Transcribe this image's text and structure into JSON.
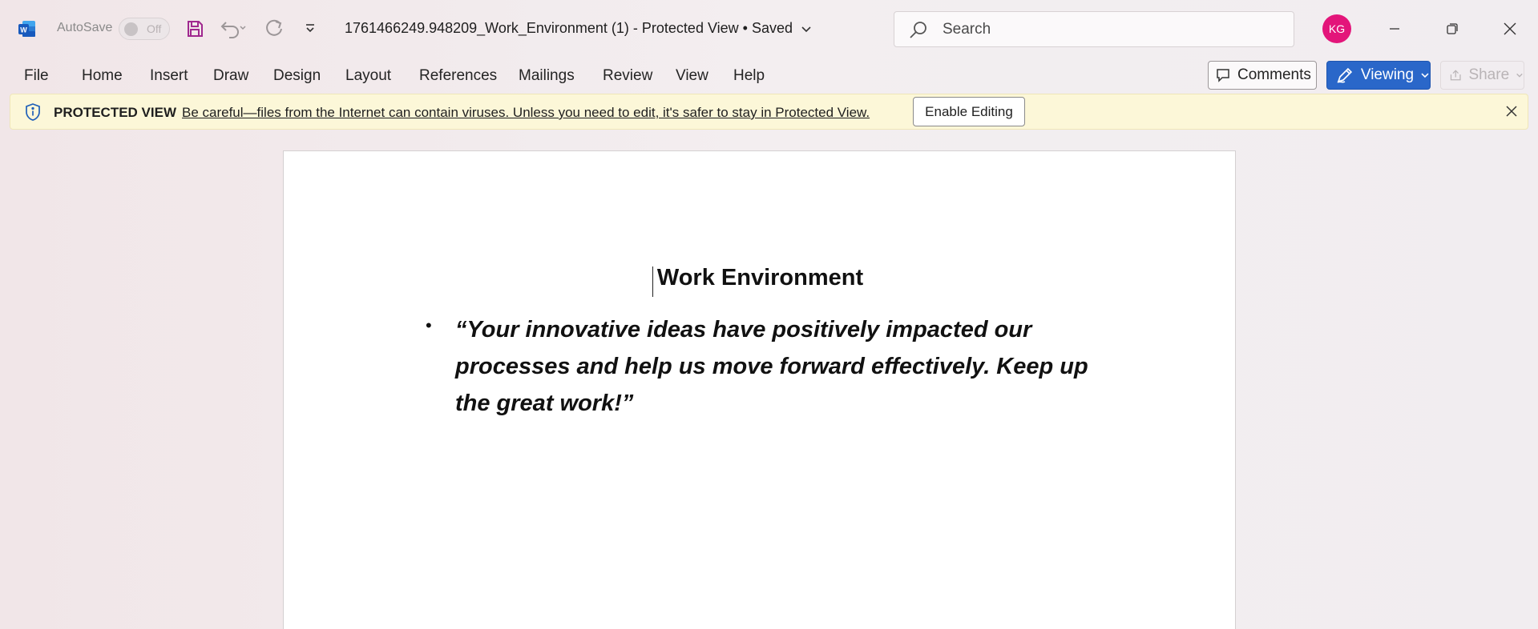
{
  "titlebar": {
    "autosave_label": "AutoSave",
    "autosave_state": "Off",
    "doc_title": "1761466249.948209_Work_Environment (1)  -  Protected View • Saved",
    "search_placeholder": "Search",
    "avatar_initials": "KG"
  },
  "menu": {
    "items": [
      "File",
      "Home",
      "Insert",
      "Draw",
      "Design",
      "Layout",
      "References",
      "Mailings",
      "Review",
      "View",
      "Help"
    ],
    "comments_label": "Comments",
    "viewing_label": "Viewing",
    "share_label": "Share"
  },
  "banner": {
    "title": "PROTECTED VIEW",
    "message": "Be careful—files from the Internet can contain viruses. Unless you need to edit, it's safer to stay in Protected View.",
    "enable_label": "Enable Editing"
  },
  "document": {
    "heading": "Work Environment",
    "bullet_text": "“Your innovative ideas have positively impacted our processes and help us move forward effectively. Keep up the great work!”"
  },
  "colors": {
    "accent": "#2a67c9",
    "avatar": "#e3157a",
    "banner": "#fcf7d8",
    "word_blue": "#185abd"
  }
}
